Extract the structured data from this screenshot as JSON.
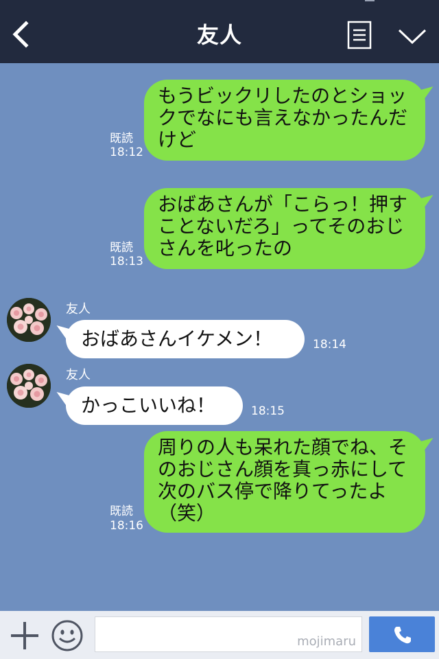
{
  "header": {
    "title": "友人"
  },
  "messages": [
    {
      "side": "out",
      "text": "もうビックリしたのとショックでなにも言えなかったんだけど",
      "read": "既読",
      "time": "18:12"
    },
    {
      "side": "out",
      "text": "おばあさんが「こらっ！押すことないだろ」ってそのおじさんを叱ったの",
      "read": "既読",
      "time": "18:13"
    },
    {
      "side": "in",
      "sender": "友人",
      "text": "おばあさんイケメン！",
      "time": "18:14"
    },
    {
      "side": "in",
      "sender": "友人",
      "text": "かっこいいね！",
      "time": "18:15"
    },
    {
      "side": "out",
      "text": "周りの人も呆れた顔でね、そのおじさん顔を真っ赤にして次のバス停で降りてったよ（笑）",
      "read": "既読",
      "time": "18:16"
    }
  ],
  "footer": {
    "watermark": "mojimaru"
  },
  "icons": {
    "back": "chevron-left-icon",
    "menu": "document-menu-icon",
    "collapse": "chevron-down-icon",
    "add": "plus-icon",
    "emoji": "smile-icon",
    "call": "phone-icon"
  },
  "colors": {
    "header": "#222a3e",
    "chat_background": "#6f8fbf",
    "outgoing_bubble": "#85e249",
    "incoming_bubble": "#ffffff",
    "call_button": "#4a82d8"
  }
}
